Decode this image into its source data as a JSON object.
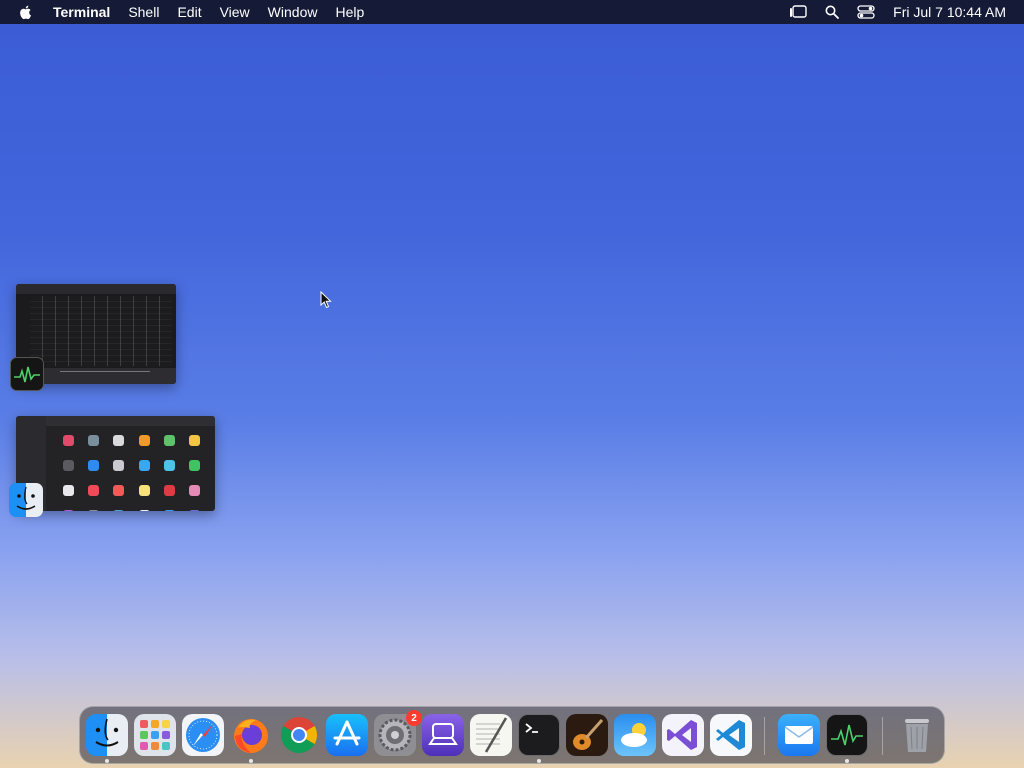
{
  "menubar": {
    "app_name": "Terminal",
    "menus": [
      "Shell",
      "Edit",
      "View",
      "Window",
      "Help"
    ],
    "clock": "Fri Jul 7  10:44 AM"
  },
  "stage_manager": {
    "windows": [
      {
        "app": "Activity Monitor",
        "icon": "activity-monitor-icon"
      },
      {
        "app": "Finder",
        "icon": "finder-icon"
      }
    ]
  },
  "dock": {
    "apps": [
      {
        "name": "Finder",
        "icon": "finder-icon",
        "running": true
      },
      {
        "name": "Launchpad",
        "icon": "launchpad-icon",
        "running": false
      },
      {
        "name": "Safari",
        "icon": "safari-icon",
        "running": false
      },
      {
        "name": "Firefox",
        "icon": "firefox-icon",
        "running": true
      },
      {
        "name": "Chrome",
        "icon": "chrome-icon",
        "running": false
      },
      {
        "name": "App Store",
        "icon": "app-store-icon",
        "running": false
      },
      {
        "name": "System Settings",
        "icon": "system-settings-icon",
        "running": false,
        "badge": "2"
      },
      {
        "name": "Apple Configurator",
        "icon": "configurator-icon",
        "running": false
      },
      {
        "name": "TextEdit",
        "icon": "textedit-icon",
        "running": false
      },
      {
        "name": "Terminal",
        "icon": "terminal-icon",
        "running": true
      },
      {
        "name": "GarageBand",
        "icon": "garageband-icon",
        "running": false
      },
      {
        "name": "Weather",
        "icon": "weather-icon",
        "running": false
      },
      {
        "name": "Visual Studio",
        "icon": "visual-studio-icon",
        "running": false
      },
      {
        "name": "Visual Studio Code",
        "icon": "vscode-icon",
        "running": false
      },
      {
        "name": "Mail",
        "icon": "mail-icon",
        "running": false
      },
      {
        "name": "Activity Monitor",
        "icon": "activity-monitor-icon",
        "running": true
      },
      {
        "name": "Trash",
        "icon": "trash-icon",
        "running": false
      }
    ]
  },
  "colors": {
    "menubar_bg": "#12162a",
    "badge": "#ff3b30",
    "desktop_top": "#3a5bd4",
    "desktop_bottom": "#e8d2b0"
  }
}
